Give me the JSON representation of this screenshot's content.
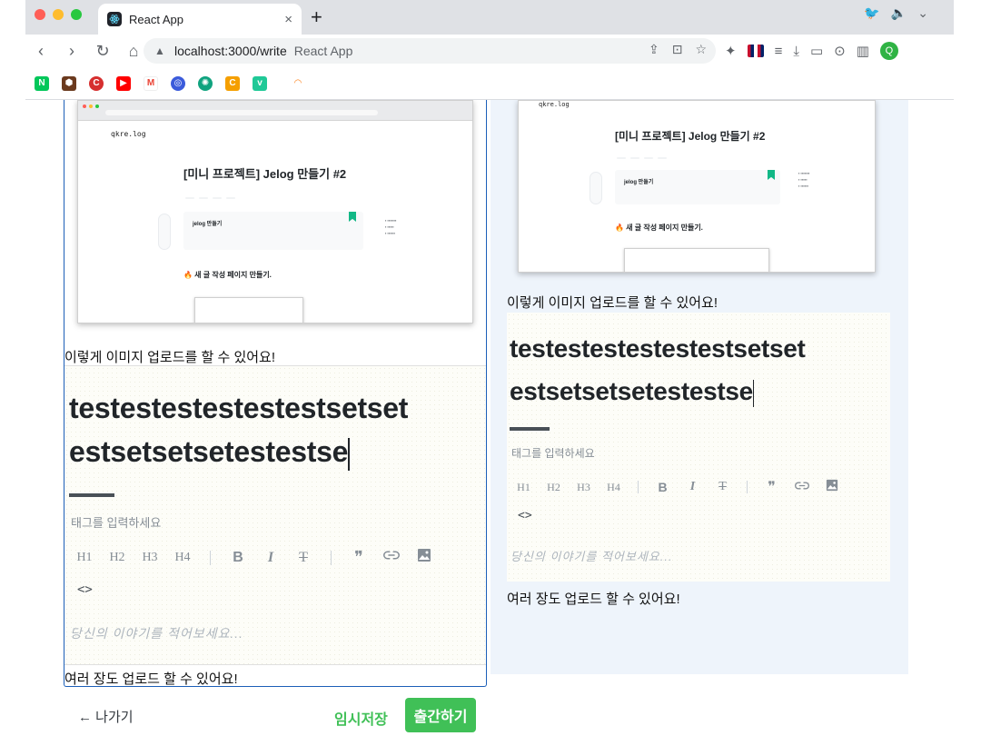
{
  "browser": {
    "tab_title": "React App",
    "url": "localhost:3000/write",
    "page_title": "React App"
  },
  "embedded_post": {
    "brand": "qkre.log",
    "title": "[미니 프로젝트] Jelog 만들기 #2",
    "series_card_title": "jelog 만들기",
    "heading": "🔥 새 글 작성 페이지 만들기."
  },
  "left_editor": {
    "image_caption": "이렇게 이미지 업로드를 할 수 있어요!",
    "title_line1": "testestestestestestsetset",
    "title_line2": "estsetsetsetestestse",
    "tag_placeholder": "태그를 입력하세요",
    "body_placeholder": "당신의 이야기를 적어보세요...",
    "upload_caption": "여러 장도 업로드 할 수 있어요!",
    "toolbar": {
      "h1": "H1",
      "h2": "H2",
      "h3": "H3",
      "h4": "H4",
      "bold": "B",
      "italic": "I",
      "strike": "T",
      "quote": "❞",
      "code": "<>"
    }
  },
  "right_preview": {
    "image_caption": "이렇게 이미지 업로드를 할 수 있어요!",
    "title_line1": "testestestestestestsetset",
    "title_line2": "estsetsetsetestestse",
    "tag_placeholder": "태그를 입력하세요",
    "body_placeholder": "당신의 이야기를 적어보세요...",
    "upload_caption": "여러 장도 업로드 할 수 있어요!"
  },
  "footer": {
    "exit_label": "← 나가기",
    "draft_label": "임시저장",
    "publish_label": "출간하기"
  },
  "colors": {
    "accent": "#40c057",
    "focus_border": "#1c5fb8",
    "preview_bg": "#eef4fb"
  }
}
